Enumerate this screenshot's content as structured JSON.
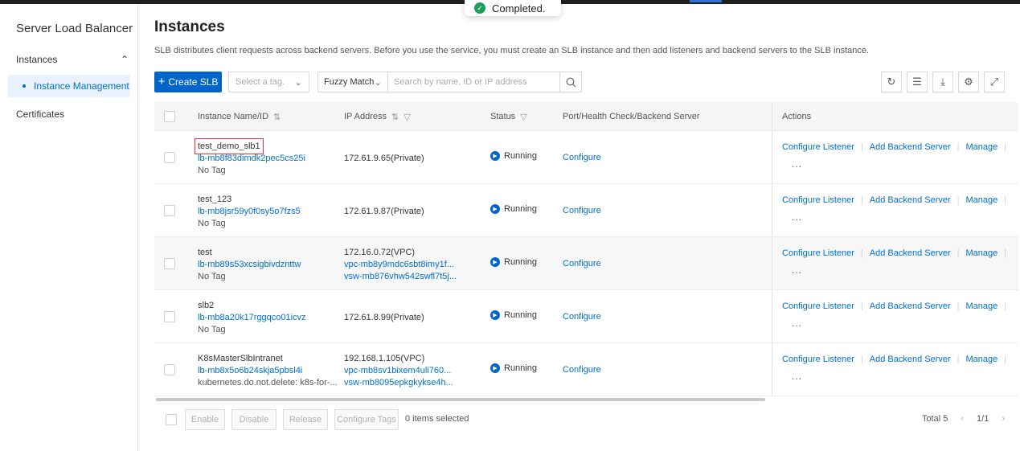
{
  "toast": {
    "text": "Completed."
  },
  "sidebar": {
    "title": "Server Load Balancer",
    "group_label": "Instances",
    "active_item": "Instance Management",
    "other_item": "Certificates"
  },
  "page": {
    "title": "Instances",
    "description": "SLB distributes client requests across backend servers. Before you use the service, you must create an SLB instance and then add listeners and backend servers to the SLB instance."
  },
  "toolbar": {
    "create_label": "Create SLB",
    "tag_placeholder": "Select a tag.",
    "match_mode": "Fuzzy Match",
    "search_placeholder": "Search by name, ID or IP address"
  },
  "table": {
    "columns": {
      "name": "Instance Name/ID",
      "ip": "IP Address",
      "status": "Status",
      "port": "Port/Health Check/Backend Server",
      "actions": "Actions"
    },
    "rows": [
      {
        "name": "test_demo_slb1",
        "id": "lb-mb8f83dimdk2pec5cs25i",
        "tag": "No Tag",
        "ip_lines": [
          "172.61.9.65(Private)"
        ],
        "ip_links": [],
        "status": "Running",
        "port": "Configure"
      },
      {
        "name": "test_123",
        "id": "lb-mb8jsr59y0f0sy5o7fzs5",
        "tag": "No Tag",
        "ip_lines": [
          "172.61.9.87(Private)"
        ],
        "ip_links": [],
        "status": "Running",
        "port": "Configure"
      },
      {
        "name": "test",
        "id": "lb-mb89s53xcsigbivdznttw",
        "tag": "No Tag",
        "ip_lines": [
          "172.16.0.72(VPC)"
        ],
        "ip_links": [
          "vpc-mb8y9mdc6sbt8imy1f...",
          "vsw-mb876vhw542swfl7t5j..."
        ],
        "status": "Running",
        "port": "Configure"
      },
      {
        "name": "slb2",
        "id": "lb-mb8a20k17rggqco01icvz",
        "tag": "No Tag",
        "ip_lines": [
          "172.61.8.99(Private)"
        ],
        "ip_links": [],
        "status": "Running",
        "port": "Configure"
      },
      {
        "name": "K8sMasterSlbIntranet",
        "id": "lb-mb8x5o6b24skja5pbsl4i",
        "tag": "kubernetes.do.not.delete: k8s-for-...",
        "ip_lines": [
          "192.168.1.105(VPC)"
        ],
        "ip_links": [
          "vpc-mb8sv1bixem4uli760...",
          "vsw-mb8095epkgkykse4h..."
        ],
        "status": "Running",
        "port": "Configure"
      }
    ],
    "actions": {
      "configure_listener": "Configure Listener",
      "add_backend": "Add Backend Server",
      "manage": "Manage",
      "more": "..."
    }
  },
  "footer": {
    "enable": "Enable",
    "disable": "Disable",
    "release": "Release",
    "configure_tags": "Configure Tags",
    "selected": "0 items selected",
    "total": "Total 5",
    "page": "1/1"
  },
  "colors": {
    "primary": "#0064c8",
    "link": "#0070cc",
    "success": "#1e9f5a",
    "highlight": "#e0353b"
  }
}
